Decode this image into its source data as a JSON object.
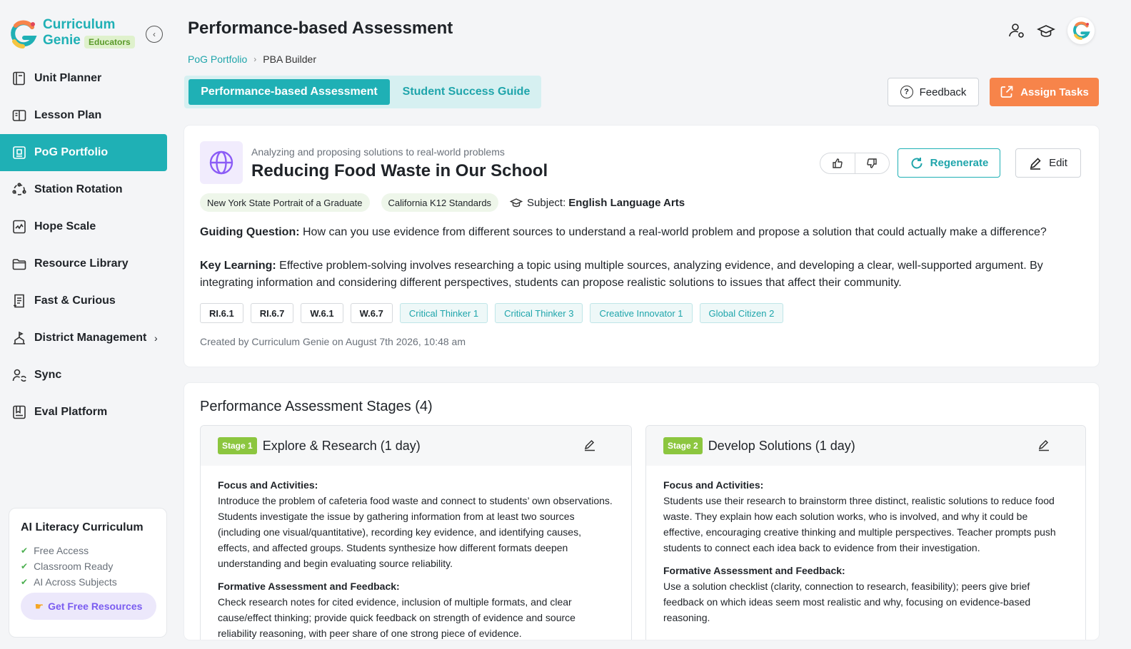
{
  "brand": {
    "line1": "Curriculum",
    "line2": "Genie",
    "badge": "Educators"
  },
  "nav": [
    {
      "label": "Unit Planner",
      "icon": "book-icon"
    },
    {
      "label": "Lesson Plan",
      "icon": "open-book-icon"
    },
    {
      "label": "PoG Portfolio",
      "icon": "portfolio-icon",
      "active": true
    },
    {
      "label": "Station Rotation",
      "icon": "rotation-icon"
    },
    {
      "label": "Hope Scale",
      "icon": "chart-icon"
    },
    {
      "label": "Resource Library",
      "icon": "folder-icon"
    },
    {
      "label": "Fast & Curious",
      "icon": "document-icon"
    },
    {
      "label": "District Management",
      "icon": "district-icon",
      "chevron": "›"
    },
    {
      "label": "Sync",
      "icon": "sync-icon"
    },
    {
      "label": "Eval Platform",
      "icon": "eval-icon"
    }
  ],
  "promo": {
    "title": "AI Literacy Curriculum",
    "items": [
      "Free Access",
      "Classroom Ready",
      "AI Across Subjects"
    ],
    "button": "Get Free Resources"
  },
  "header": {
    "title": "Performance-based Assessment",
    "breadcrumb": {
      "link": "PoG Portfolio",
      "current": "PBA Builder"
    }
  },
  "tabs": {
    "active": "Performance-based Assessment",
    "inactive": "Student Success Guide"
  },
  "actions": {
    "feedback": "Feedback",
    "assign": "Assign Tasks"
  },
  "card": {
    "subtitle": "Analyzing and proposing solutions to real-world problems",
    "title": "Reducing Food Waste in Our School",
    "regenerate": "Regenerate",
    "edit": "Edit",
    "standards": [
      "New York State Portrait of a Graduate",
      "California K12 Standards"
    ],
    "subject_label": "Subject:",
    "subject_value": "English Language Arts",
    "guiding_label": "Guiding Question:",
    "guiding_text": "How can you use evidence from different sources to understand a real-world problem and propose a solution that could actually make a difference?",
    "key_label": "Key Learning:",
    "key_text": "Effective problem-solving involves researching a topic using multiple sources, analyzing evidence, and developing a clear, well-supported argument. By integrating information and considering different perspectives, students can propose realistic solutions to issues that affect their community.",
    "std_tags": [
      "RI.6.1",
      "RI.6.7",
      "W.6.1",
      "W.6.7"
    ],
    "pog_tags": [
      "Critical Thinker 1",
      "Critical Thinker 3",
      "Creative Innovator 1",
      "Global Citizen 2"
    ],
    "created": "Created by Curriculum Genie on August 7th 2026, 10:48 am"
  },
  "stages": {
    "title": "Performance Assessment Stages (4)",
    "items": [
      {
        "badge": "Stage 1",
        "name": "Explore & Research (1 day)",
        "focus_label": "Focus and Activities:",
        "focus_text": "Introduce the problem of cafeteria food waste and connect to students’ own observations. Students investigate the issue by gathering information from at least two sources (including one visual/quantitative), recording key evidence, and identifying causes, effects, and affected groups. Students synthesize how different formats deepen understanding and begin evaluating source reliability.",
        "formative_label": "Formative Assessment and Feedback:",
        "formative_text": "Check research notes for cited evidence, inclusion of multiple formats, and clear cause/effect thinking; provide quick feedback on strength of evidence and source reliability reasoning, with peer share of one strong piece of evidence."
      },
      {
        "badge": "Stage 2",
        "name": "Develop Solutions (1 day)",
        "focus_label": "Focus and Activities:",
        "focus_text": "Students use their research to brainstorm three distinct, realistic solutions to reduce food waste. They explain how each solution works, who is involved, and why it could be effective, encouraging creative thinking and multiple perspectives. Teacher prompts push students to connect each idea back to evidence from their investigation.",
        "formative_label": "Formative Assessment and Feedback:",
        "formative_text": "Use a solution checklist (clarity, connection to research, feasibility); peers give brief feedback on which ideas seem most realistic and why, focusing on evidence-based reasoning."
      }
    ]
  },
  "colors": {
    "accent": "#1fb0b5",
    "orange": "#f7844a",
    "green": "#8cc63f",
    "purple": "#7a5cf0"
  }
}
